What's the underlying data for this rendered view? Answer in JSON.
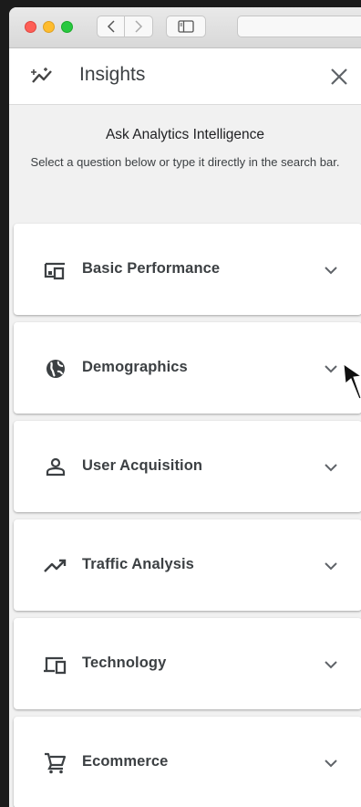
{
  "panel": {
    "title": "Insights",
    "intro_title": "Ask Analytics Intelligence",
    "intro_text": "Select a question below or type it directly in the search bar."
  },
  "categories": [
    {
      "label": "Basic Performance",
      "icon": "devices-icon"
    },
    {
      "label": "Demographics",
      "icon": "globe-icon"
    },
    {
      "label": "User Acquisition",
      "icon": "person-icon"
    },
    {
      "label": "Traffic Analysis",
      "icon": "trending-up-icon"
    },
    {
      "label": "Technology",
      "icon": "computer-icon"
    },
    {
      "label": "Ecommerce",
      "icon": "shopping-cart-icon"
    }
  ],
  "colors": {
    "text": "#3c4043",
    "background": "#f1f1f1",
    "card": "#ffffff"
  }
}
